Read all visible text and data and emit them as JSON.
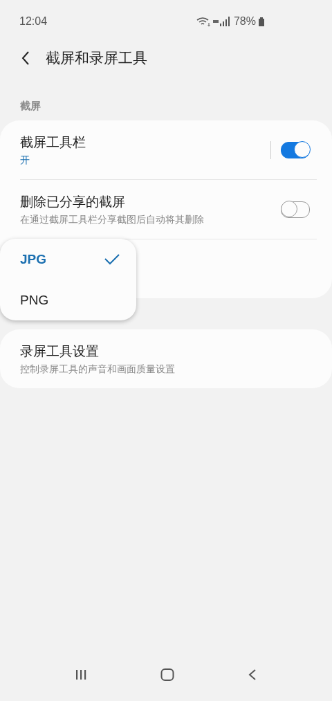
{
  "status_bar": {
    "time": "12:04",
    "battery": "78%"
  },
  "header": {
    "title": "截屏和录屏工具"
  },
  "section": {
    "title": "截屏"
  },
  "settings": [
    {
      "title": "截屏工具栏",
      "subtitle": "开",
      "kind": "status",
      "on": true
    },
    {
      "title": "删除已分享的截屏",
      "subtitle": "在通过截屏工具栏分享截图后自动将其删除",
      "kind": "description",
      "on": false
    }
  ],
  "format_menu": [
    {
      "label": "JPG",
      "selected": true
    },
    {
      "label": "PNG",
      "selected": false
    }
  ],
  "recorder": {
    "title": "录屏工具设置",
    "subtitle": "控制录屏工具的声音和画面质量设置"
  }
}
